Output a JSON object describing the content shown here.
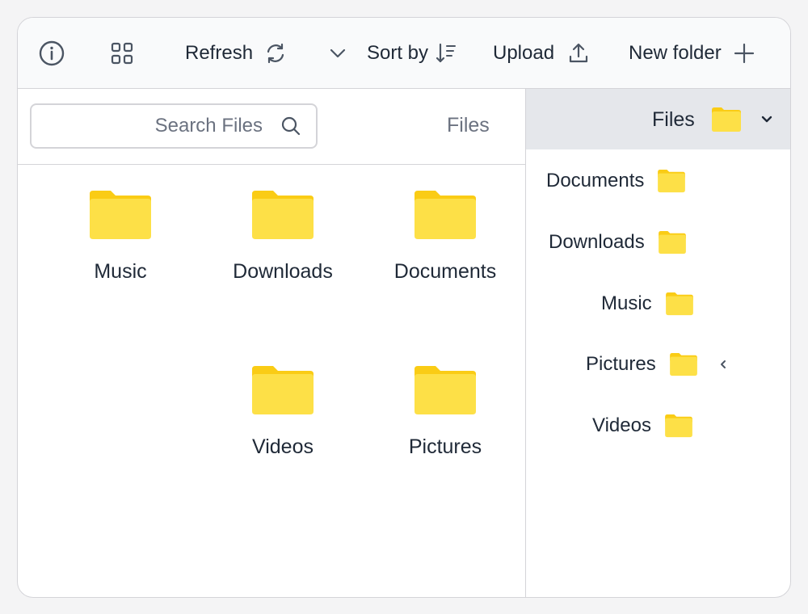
{
  "toolbar": {
    "refresh_label": "Refresh",
    "sort_label": "Sort by",
    "upload_label": "Upload",
    "new_folder_label": "New folder"
  },
  "search": {
    "placeholder": "Search Files"
  },
  "main": {
    "pane_title": "Files",
    "folders": [
      "Music",
      "Downloads",
      "Documents",
      "Videos",
      "Pictures"
    ]
  },
  "tree": {
    "root_label": "Files",
    "items": [
      "Documents",
      "Downloads",
      "Music",
      "Pictures",
      "Videos"
    ]
  },
  "colors": {
    "folder_front": "#fde047",
    "folder_back": "#facc15",
    "border": "#d4d4d8",
    "header_bg": "#e5e7eb"
  }
}
